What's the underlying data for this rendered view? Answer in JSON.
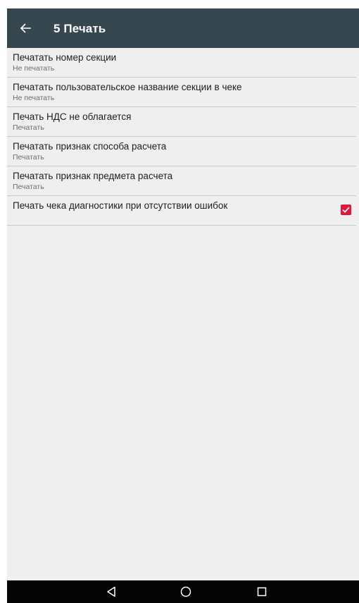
{
  "appbar": {
    "title": "5 Печать",
    "back_icon": "arrow-left-icon"
  },
  "settings": [
    {
      "title": "Печатать номер секции",
      "summary": "Не печатать"
    },
    {
      "title": "Печатать пользовательское название секции в чеке",
      "summary": "Не печатать"
    },
    {
      "title": "Печать НДС не облагается",
      "summary": "Печатать"
    },
    {
      "title": "Печатать признак способа расчета",
      "summary": "Печатать"
    },
    {
      "title": "Печатать признак предмета расчета",
      "summary": "Печатать"
    },
    {
      "title": "Печать чека диагностики при отсутствии ошибок",
      "checked": true
    }
  ],
  "navbar": {
    "icons": [
      "back-triangle-icon",
      "home-circle-icon",
      "recents-square-icon"
    ]
  },
  "colors": {
    "appbar": "#37474f",
    "background": "#efefef",
    "checkbox": "#e0193a",
    "navbar": "#050505"
  }
}
